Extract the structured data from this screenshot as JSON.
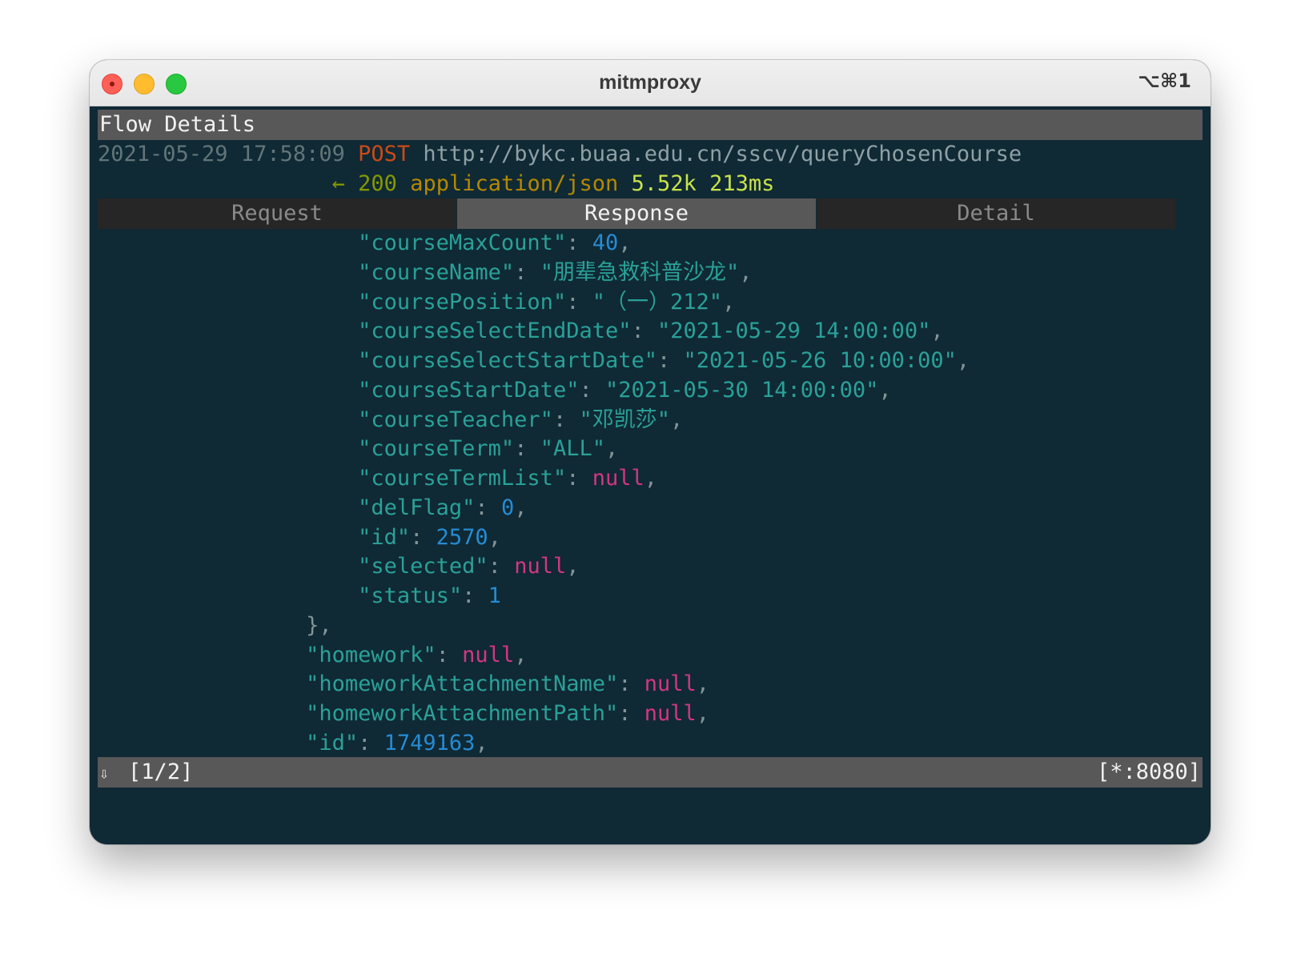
{
  "window": {
    "title": "mitmproxy",
    "shortcut": "⌥⌘1"
  },
  "header": {
    "title": "Flow Details"
  },
  "request": {
    "timestamp": "2021-05-29 17:58:09",
    "method": "POST",
    "url": "http://bykc.buaa.edu.cn/sscv/queryChosenCourse"
  },
  "response": {
    "arrow": "←",
    "status_code": "200",
    "content_type": "application/json",
    "size": "5.52k",
    "duration": "213ms"
  },
  "tabs": [
    {
      "label": "Request",
      "active": false
    },
    {
      "label": "Response",
      "active": true
    },
    {
      "label": "Detail",
      "active": false
    }
  ],
  "body_lines": [
    {
      "indent": 8,
      "key": "courseMaxCount",
      "value": "40",
      "vtype": "num",
      "comma": true
    },
    {
      "indent": 8,
      "key": "courseName",
      "value": "\"朋辈急救科普沙龙\"",
      "vtype": "str",
      "comma": true
    },
    {
      "indent": 8,
      "key": "coursePosition",
      "value": "\"（一）212\"",
      "vtype": "str",
      "comma": true
    },
    {
      "indent": 8,
      "key": "courseSelectEndDate",
      "value": "\"2021-05-29 14:00:00\"",
      "vtype": "str",
      "comma": true
    },
    {
      "indent": 8,
      "key": "courseSelectStartDate",
      "value": "\"2021-05-26 10:00:00\"",
      "vtype": "str",
      "comma": true
    },
    {
      "indent": 8,
      "key": "courseStartDate",
      "value": "\"2021-05-30 14:00:00\"",
      "vtype": "str",
      "comma": true
    },
    {
      "indent": 8,
      "key": "courseTeacher",
      "value": "\"邓凯莎\"",
      "vtype": "str",
      "comma": true
    },
    {
      "indent": 8,
      "key": "courseTerm",
      "value": "\"ALL\"",
      "vtype": "str",
      "comma": true
    },
    {
      "indent": 8,
      "key": "courseTermList",
      "value": "null",
      "vtype": "null",
      "comma": true
    },
    {
      "indent": 8,
      "key": "delFlag",
      "value": "0",
      "vtype": "num",
      "comma": true
    },
    {
      "indent": 8,
      "key": "id",
      "value": "2570",
      "vtype": "num",
      "comma": true
    },
    {
      "indent": 8,
      "key": "selected",
      "value": "null",
      "vtype": "null",
      "comma": true
    },
    {
      "indent": 8,
      "key": "status",
      "value": "1",
      "vtype": "num",
      "comma": false
    },
    {
      "indent": 6,
      "raw": "},"
    },
    {
      "indent": 6,
      "key": "homework",
      "value": "null",
      "vtype": "null",
      "comma": true
    },
    {
      "indent": 6,
      "key": "homeworkAttachmentName",
      "value": "null",
      "vtype": "null",
      "comma": true
    },
    {
      "indent": 6,
      "key": "homeworkAttachmentPath",
      "value": "null",
      "vtype": "null",
      "comma": true
    },
    {
      "indent": 6,
      "key": "id",
      "value": "1749163",
      "vtype": "num",
      "comma": true
    }
  ],
  "statusbar": {
    "scroll_icon": "⇩",
    "page": "[1/2]",
    "listen": "[*:8080]"
  },
  "colors": {
    "background": "#0f2935",
    "bar": "#585858",
    "key": "#2aa198",
    "number": "#268bd2",
    "null": "#d33682",
    "method": "#cb4b16",
    "status_ok": "#859900"
  }
}
